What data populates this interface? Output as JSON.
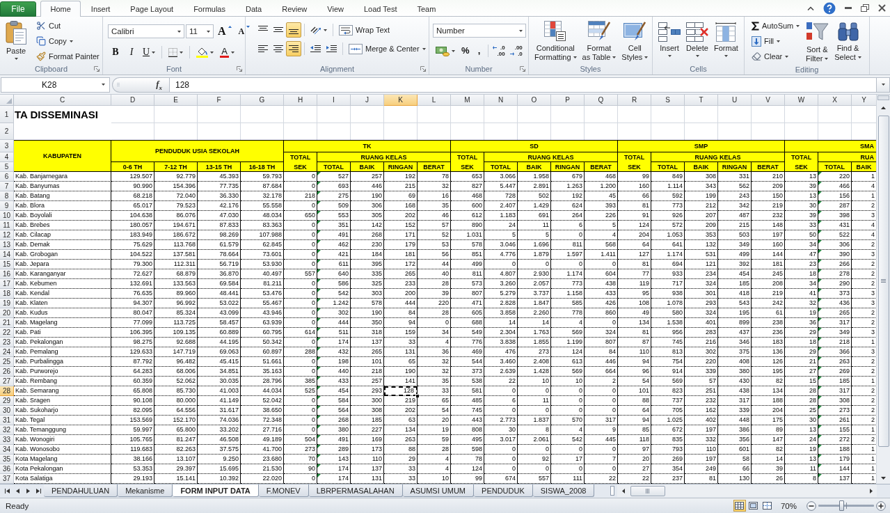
{
  "ribbon_tabs": [
    {
      "label": "File",
      "kind": "file",
      "selected": false
    },
    {
      "label": "Home",
      "kind": "tab",
      "selected": true
    },
    {
      "label": "Insert",
      "kind": "tab",
      "selected": false
    },
    {
      "label": "Page Layout",
      "kind": "tab",
      "selected": false
    },
    {
      "label": "Formulas",
      "kind": "tab",
      "selected": false
    },
    {
      "label": "Data",
      "kind": "tab",
      "selected": false
    },
    {
      "label": "Review",
      "kind": "tab",
      "selected": false
    },
    {
      "label": "View",
      "kind": "tab",
      "selected": false
    },
    {
      "label": "Load Test",
      "kind": "tab",
      "selected": false
    },
    {
      "label": "Team",
      "kind": "tab",
      "selected": false
    }
  ],
  "clipboard": {
    "label": "Clipboard",
    "paste": "Paste",
    "cut": "Cut",
    "copy": "Copy",
    "format_painter": "Format Painter"
  },
  "font": {
    "label": "Font",
    "name": "Calibri",
    "size": "11",
    "grow": "A",
    "shrink": "A",
    "bold": "B",
    "italic": "I",
    "underline": "U",
    "font_color": "A"
  },
  "alignment": {
    "label": "Alignment",
    "vertical": [
      {
        "selected": false
      },
      {
        "selected": false
      },
      {
        "selected": true
      }
    ],
    "horizontal": [
      {
        "selected": false
      },
      {
        "selected": false
      },
      {
        "selected": true
      }
    ],
    "wrap_text": "Wrap Text",
    "merge_center": "Merge & Center"
  },
  "number": {
    "label": "Number",
    "format": "Number",
    "percent": "%",
    "comma": ",",
    "decimals": [
      {
        "kind": "increase",
        "top": ".0",
        "bottom": ".00"
      },
      {
        "kind": "decrease",
        "top": ".00",
        "bottom": ".0"
      }
    ]
  },
  "styles": {
    "label": "Styles",
    "buttons": [
      {
        "kind": "conditional",
        "lines": [
          "Conditional",
          "Formatting"
        ]
      },
      {
        "kind": "table",
        "lines": [
          "Format",
          "as Table"
        ]
      },
      {
        "kind": "cell",
        "lines": [
          "Cell",
          "Styles"
        ]
      }
    ]
  },
  "cells": {
    "label": "Cells",
    "buttons": [
      {
        "kind": "insert",
        "label": "Insert"
      },
      {
        "kind": "delete",
        "label": "Delete"
      },
      {
        "kind": "format",
        "label": "Format"
      }
    ]
  },
  "editing": {
    "label": "Editing",
    "autosum": "AutoSum",
    "fill": "Fill",
    "clear": "Clear",
    "sort_filter": [
      "Sort &",
      "Filter"
    ],
    "find_select": [
      "Find &",
      "Select"
    ]
  },
  "formula_bar": {
    "name_box": "K28",
    "function_label": "f$_{x}$",
    "value": "128"
  },
  "sheet": {
    "title": "TA DISSEMINASI",
    "column_headers": [
      {
        "label": "C",
        "selected": false,
        "flagged": false
      },
      {
        "label": "D",
        "selected": false,
        "flagged": false
      },
      {
        "label": "E",
        "selected": false,
        "flagged": false
      },
      {
        "label": "F",
        "selected": false,
        "flagged": false
      },
      {
        "label": "G",
        "selected": false,
        "flagged": false
      },
      {
        "label": "H",
        "selected": false,
        "flagged": false
      },
      {
        "label": "I",
        "selected": false,
        "flagged": true
      },
      {
        "label": "J",
        "selected": false,
        "flagged": false
      },
      {
        "label": "K",
        "selected": true,
        "flagged": false
      },
      {
        "label": "L",
        "selected": false,
        "flagged": false
      },
      {
        "label": "M",
        "selected": false,
        "flagged": false
      },
      {
        "label": "N",
        "selected": false,
        "flagged": false
      },
      {
        "label": "O",
        "selected": false,
        "flagged": false
      },
      {
        "label": "P",
        "selected": false,
        "flagged": false
      },
      {
        "label": "Q",
        "selected": false,
        "flagged": false
      },
      {
        "label": "R",
        "selected": false,
        "flagged": false
      },
      {
        "label": "S",
        "selected": false,
        "flagged": false
      },
      {
        "label": "T",
        "selected": false,
        "flagged": false
      },
      {
        "label": "U",
        "selected": false,
        "flagged": false
      },
      {
        "label": "V",
        "selected": false,
        "flagged": false
      },
      {
        "label": "W",
        "selected": false,
        "flagged": false
      },
      {
        "label": "X",
        "selected": false,
        "flagged": true
      },
      {
        "label": "Y",
        "selected": false,
        "flagged": false
      }
    ],
    "row_headers": [
      {
        "label": "1",
        "selected": false
      },
      {
        "label": "2",
        "selected": false
      },
      {
        "label": "3",
        "selected": false
      },
      {
        "label": "4",
        "selected": false
      },
      {
        "label": "5",
        "selected": false
      },
      {
        "label": "6",
        "selected": false
      },
      {
        "label": "7",
        "selected": false
      },
      {
        "label": "8",
        "selected": false
      },
      {
        "label": "9",
        "selected": false
      },
      {
        "label": "10",
        "selected": false
      },
      {
        "label": "11",
        "selected": false
      },
      {
        "label": "12",
        "selected": false
      },
      {
        "label": "13",
        "selected": false
      },
      {
        "label": "14",
        "selected": false
      },
      {
        "label": "15",
        "selected": false
      },
      {
        "label": "16",
        "selected": false
      },
      {
        "label": "17",
        "selected": false
      },
      {
        "label": "18",
        "selected": false
      },
      {
        "label": "19",
        "selected": false
      },
      {
        "label": "20",
        "selected": false
      },
      {
        "label": "21",
        "selected": false
      },
      {
        "label": "22",
        "selected": false
      },
      {
        "label": "23",
        "selected": false
      },
      {
        "label": "24",
        "selected": false
      },
      {
        "label": "25",
        "selected": false
      },
      {
        "label": "26",
        "selected": false
      },
      {
        "label": "27",
        "selected": false
      },
      {
        "label": "28",
        "selected": true
      },
      {
        "label": "29",
        "selected": false
      },
      {
        "label": "30",
        "selected": false
      },
      {
        "label": "31",
        "selected": false
      },
      {
        "label": "32",
        "selected": false
      },
      {
        "label": "33",
        "selected": false
      },
      {
        "label": "34",
        "selected": false
      },
      {
        "label": "35",
        "selected": false
      },
      {
        "label": "36",
        "selected": false
      },
      {
        "label": "37",
        "selected": false
      }
    ],
    "table": {
      "kabupaten": "KABUPATEN",
      "groups": [
        {
          "kind": "population",
          "title": "PENDUDUK USIA SEKOLAH",
          "columns": [
            "0-6 TH",
            "7-12 TH",
            "13-15 TH",
            "16-18 TH"
          ]
        },
        {
          "kind": "school",
          "title": "TK",
          "total_label": "TOTAL SEK",
          "rooms_label": "RUANG KELAS",
          "columns": [
            "TOTAL",
            "BAIK",
            "RINGAN",
            "BERAT"
          ]
        },
        {
          "kind": "school",
          "title": "SD",
          "total_label": "TOTAL SEK",
          "rooms_label": "RUANG KELAS",
          "columns": [
            "TOTAL",
            "BAIK",
            "RINGAN",
            "BERAT"
          ]
        },
        {
          "kind": "school",
          "title": "SMP",
          "total_label": "TOTAL SEK",
          "rooms_label": "RUANG KELAS",
          "columns": [
            "TOTAL",
            "BAIK",
            "RINGAN",
            "BERAT"
          ]
        },
        {
          "kind": "school",
          "title": "SMA",
          "total_label": "TOTAL SEK",
          "rooms_label": "RUA",
          "columns": [
            "TOTAL",
            "BAIK"
          ]
        }
      ],
      "rows": [
        {
          "name": "Kab. Banjarnegara",
          "values": [
            "129.507",
            "92.779",
            "45.393",
            "59.793",
            "0",
            "527",
            "257",
            "192",
            "78",
            "653",
            "3.066",
            "1.958",
            "679",
            "468",
            "99",
            "849",
            "308",
            "331",
            "210",
            "13",
            "220",
            "1"
          ]
        },
        {
          "name": "Kab. Banyumas",
          "values": [
            "90.990",
            "154.396",
            "77.735",
            "87.684",
            "0",
            "693",
            "446",
            "215",
            "32",
            "827",
            "5.447",
            "2.891",
            "1.263",
            "1.200",
            "160",
            "1.114",
            "343",
            "562",
            "209",
            "39",
            "466",
            "4"
          ]
        },
        {
          "name": "Kab. Batang",
          "values": [
            "68.218",
            "72.040",
            "36.330",
            "32.178",
            "218",
            "275",
            "190",
            "69",
            "16",
            "468",
            "728",
            "502",
            "192",
            "45",
            "66",
            "592",
            "199",
            "243",
            "150",
            "13",
            "156",
            "1"
          ]
        },
        {
          "name": "Kab. Blora",
          "values": [
            "65.017",
            "79.523",
            "42.176",
            "55.558",
            "0",
            "509",
            "306",
            "168",
            "35",
            "600",
            "2.407",
            "1.429",
            "624",
            "393",
            "81",
            "773",
            "212",
            "342",
            "219",
            "30",
            "287",
            "2"
          ]
        },
        {
          "name": "Kab. Boyolali",
          "values": [
            "104.638",
            "86.076",
            "47.030",
            "48.034",
            "650",
            "553",
            "305",
            "202",
            "46",
            "612",
            "1.183",
            "691",
            "264",
            "226",
            "91",
            "926",
            "207",
            "487",
            "232",
            "39",
            "398",
            "3"
          ]
        },
        {
          "name": "Kab. Brebes",
          "values": [
            "180.057",
            "194.671",
            "87.833",
            "83.363",
            "0",
            "351",
            "142",
            "152",
            "57",
            "890",
            "24",
            "11",
            "6",
            "5",
            "124",
            "572",
            "209",
            "215",
            "148",
            "33",
            "431",
            "4"
          ]
        },
        {
          "name": "Kab. Cilacap",
          "values": [
            "183.949",
            "186.672",
            "98.269",
            "107.988",
            "0",
            "491",
            "268",
            "171",
            "52",
            "1.031",
            "5",
            "5",
            "0",
            "4",
            "204",
            "1.053",
            "353",
            "503",
            "197",
            "50",
            "522",
            "4"
          ]
        },
        {
          "name": "Kab. Demak",
          "values": [
            "75.629",
            "113.768",
            "61.579",
            "62.845",
            "0",
            "462",
            "230",
            "179",
            "53",
            "578",
            "3.046",
            "1.696",
            "811",
            "568",
            "64",
            "641",
            "132",
            "349",
            "160",
            "34",
            "306",
            "2"
          ]
        },
        {
          "name": "Kab. Grobogan",
          "values": [
            "104.522",
            "137.581",
            "78.664",
            "73.601",
            "0",
            "421",
            "184",
            "181",
            "56",
            "851",
            "4.776",
            "1.879",
            "1.597",
            "1.411",
            "127",
            "1.174",
            "531",
            "499",
            "144",
            "47",
            "390",
            "3"
          ]
        },
        {
          "name": "Kab. Jepara",
          "values": [
            "79.300",
            "112.311",
            "56.719",
            "53.930",
            "0",
            "611",
            "395",
            "172",
            "44",
            "499",
            "0",
            "0",
            "0",
            "0",
            "81",
            "694",
            "121",
            "392",
            "181",
            "23",
            "266",
            "2"
          ]
        },
        {
          "name": "Kab. Karanganyar",
          "values": [
            "72.627",
            "68.879",
            "36.870",
            "40.497",
            "557",
            "640",
            "335",
            "265",
            "40",
            "811",
            "4.807",
            "2.930",
            "1.174",
            "604",
            "77",
            "933",
            "234",
            "454",
            "245",
            "18",
            "278",
            "2"
          ]
        },
        {
          "name": "Kab. Kebumen",
          "values": [
            "132.691",
            "133.563",
            "69.584",
            "81.211",
            "0",
            "586",
            "325",
            "233",
            "28",
            "573",
            "3.260",
            "2.057",
            "773",
            "438",
            "119",
            "717",
            "324",
            "185",
            "208",
            "34",
            "290",
            "2"
          ]
        },
        {
          "name": "Kab. Kendal",
          "values": [
            "76.635",
            "89.960",
            "48.441",
            "53.476",
            "0",
            "542",
            "303",
            "200",
            "39",
            "807",
            "5.279",
            "3.737",
            "1.158",
            "433",
            "95",
            "938",
            "301",
            "418",
            "219",
            "41",
            "373",
            "3"
          ]
        },
        {
          "name": "Kab. Klaten",
          "values": [
            "94.307",
            "96.992",
            "53.022",
            "55.467",
            "0",
            "1.242",
            "578",
            "444",
            "220",
            "471",
            "2.828",
            "1.847",
            "585",
            "426",
            "108",
            "1.078",
            "293",
            "543",
            "242",
            "32",
            "436",
            "3"
          ]
        },
        {
          "name": "Kab. Kudus",
          "values": [
            "80.047",
            "85.324",
            "43.099",
            "43.946",
            "0",
            "302",
            "190",
            "84",
            "28",
            "605",
            "3.858",
            "2.260",
            "778",
            "860",
            "49",
            "580",
            "324",
            "195",
            "61",
            "19",
            "265",
            "2"
          ]
        },
        {
          "name": "Kab. Magelang",
          "values": [
            "77.099",
            "113.725",
            "58.457",
            "63.939",
            "0",
            "444",
            "350",
            "94",
            "0",
            "688",
            "14",
            "14",
            "4",
            "0",
            "134",
            "1.538",
            "401",
            "899",
            "238",
            "36",
            "317",
            "2"
          ]
        },
        {
          "name": "Kab. Pati",
          "values": [
            "106.395",
            "109.135",
            "60.889",
            "60.795",
            "614",
            "511",
            "318",
            "159",
            "34",
            "549",
            "2.304",
            "1.763",
            "569",
            "324",
            "81",
            "956",
            "283",
            "437",
            "236",
            "29",
            "349",
            "3"
          ]
        },
        {
          "name": "Kab. Pekalongan",
          "values": [
            "98.275",
            "92.688",
            "44.195",
            "50.342",
            "0",
            "174",
            "137",
            "33",
            "4",
            "776",
            "3.838",
            "1.855",
            "1.199",
            "807",
            "87",
            "745",
            "216",
            "346",
            "183",
            "18",
            "218",
            "1"
          ]
        },
        {
          "name": "Kab. Pemalang",
          "values": [
            "129.633",
            "147.719",
            "69.063",
            "60.897",
            "288",
            "432",
            "265",
            "131",
            "36",
            "469",
            "476",
            "273",
            "124",
            "84",
            "110",
            "813",
            "302",
            "375",
            "136",
            "29",
            "366",
            "3"
          ]
        },
        {
          "name": "Kab. Purbalingga",
          "values": [
            "87.792",
            "96.482",
            "45.415",
            "51.661",
            "0",
            "198",
            "101",
            "65",
            "32",
            "544",
            "3.460",
            "2.408",
            "613",
            "446",
            "94",
            "754",
            "220",
            "408",
            "126",
            "21",
            "263",
            "2"
          ]
        },
        {
          "name": "Kab. Purworejo",
          "values": [
            "64.283",
            "68.006",
            "34.851",
            "35.163",
            "0",
            "440",
            "218",
            "190",
            "32",
            "373",
            "2.639",
            "1.428",
            "569",
            "664",
            "96",
            "914",
            "339",
            "380",
            "195",
            "27",
            "269",
            "2"
          ]
        },
        {
          "name": "Kab. Rembang",
          "values": [
            "60.359",
            "52.062",
            "30.035",
            "28.796",
            "385",
            "433",
            "257",
            "141",
            "35",
            "538",
            "22",
            "10",
            "10",
            "2",
            "54",
            "569",
            "57",
            "430",
            "82",
            "15",
            "185",
            "1"
          ]
        },
        {
          "name": "Kab. Semarang",
          "values": [
            "65.808",
            "85.730",
            "41.003",
            "44.034",
            "525",
            "454",
            "293",
            "128",
            "33",
            "581",
            "0",
            "0",
            "0",
            "0",
            "101",
            "823",
            "251",
            "438",
            "134",
            "28",
            "317",
            "2"
          ]
        },
        {
          "name": "Kab. Sragen",
          "values": [
            "90.108",
            "80.000",
            "41.149",
            "52.042",
            "0",
            "584",
            "300",
            "219",
            "65",
            "485",
            "6",
            "11",
            "0",
            "0",
            "88",
            "737",
            "232",
            "317",
            "188",
            "28",
            "308",
            "2"
          ]
        },
        {
          "name": "Kab. Sukoharjo",
          "values": [
            "82.095",
            "64.556",
            "31.617",
            "38.650",
            "0",
            "564",
            "308",
            "202",
            "54",
            "745",
            "0",
            "0",
            "0",
            "0",
            "64",
            "705",
            "162",
            "339",
            "204",
            "25",
            "273",
            "2"
          ]
        },
        {
          "name": "Kab. Tegal",
          "values": [
            "153.569",
            "152.170",
            "74.036",
            "72.348",
            "0",
            "268",
            "185",
            "63",
            "20",
            "443",
            "2.773",
            "1.837",
            "570",
            "317",
            "94",
            "1.025",
            "402",
            "448",
            "175",
            "30",
            "261",
            "2"
          ]
        },
        {
          "name": "Kab. Temanggung",
          "values": [
            "59.997",
            "65.800",
            "33.202",
            "27.716",
            "0",
            "380",
            "227",
            "134",
            "19",
            "808",
            "30",
            "8",
            "4",
            "9",
            "85",
            "672",
            "197",
            "386",
            "89",
            "13",
            "155",
            "1"
          ]
        },
        {
          "name": "Kab. Wonogiri",
          "values": [
            "105.765",
            "81.247",
            "46.508",
            "49.189",
            "504",
            "491",
            "169",
            "263",
            "59",
            "495",
            "3.017",
            "2.061",
            "542",
            "445",
            "118",
            "835",
            "332",
            "356",
            "147",
            "24",
            "272",
            "2"
          ]
        },
        {
          "name": "Kab. Wonosobo",
          "values": [
            "119.683",
            "82.263",
            "37.575",
            "41.700",
            "273",
            "289",
            "173",
            "88",
            "28",
            "598",
            "0",
            "0",
            "0",
            "0",
            "97",
            "793",
            "110",
            "601",
            "82",
            "19",
            "188",
            "1"
          ]
        },
        {
          "name": "Kota Magelang",
          "values": [
            "38.166",
            "13.107",
            "9.250",
            "23.680",
            "70",
            "143",
            "110",
            "29",
            "4",
            "78",
            "0",
            "92",
            "17",
            "7",
            "20",
            "269",
            "197",
            "58",
            "14",
            "13",
            "179",
            "1"
          ]
        },
        {
          "name": "Kota Pekalongan",
          "values": [
            "53.353",
            "29.397",
            "15.695",
            "21.530",
            "90",
            "174",
            "137",
            "33",
            "4",
            "124",
            "0",
            "0",
            "0",
            "0",
            "27",
            "354",
            "249",
            "66",
            "39",
            "11",
            "144",
            "1"
          ]
        },
        {
          "name": "Kota Salatiga",
          "values": [
            "29.193",
            "15.141",
            "10.392",
            "22.020",
            "0",
            "174",
            "131",
            "33",
            "10",
            "99",
            "674",
            "557",
            "111",
            "22",
            "22",
            "237",
            "81",
            "130",
            "26",
            "8",
            "137",
            "1"
          ]
        }
      ]
    }
  },
  "sheet_tabs": [
    {
      "label": "PENDAHULUAN",
      "selected": false
    },
    {
      "label": "Mekanisme",
      "selected": false
    },
    {
      "label": "FORM INPUT DATA",
      "selected": true
    },
    {
      "label": "F.MONEV",
      "selected": false
    },
    {
      "label": "LBRPERMASALAHAN",
      "selected": false
    },
    {
      "label": "ASUMSI UMUM",
      "selected": false
    },
    {
      "label": "PENDUDUK",
      "selected": false
    },
    {
      "label": "SISWA_2008",
      "selected": false
    }
  ],
  "status_bar": {
    "status": "Ready",
    "views": [
      {
        "kind": "normal",
        "selected": true
      },
      {
        "kind": "page_layout",
        "selected": false
      },
      {
        "kind": "page_break",
        "selected": false
      }
    ],
    "zoom": "70%",
    "zoom_slider": {
      "level": 0.41
    }
  }
}
